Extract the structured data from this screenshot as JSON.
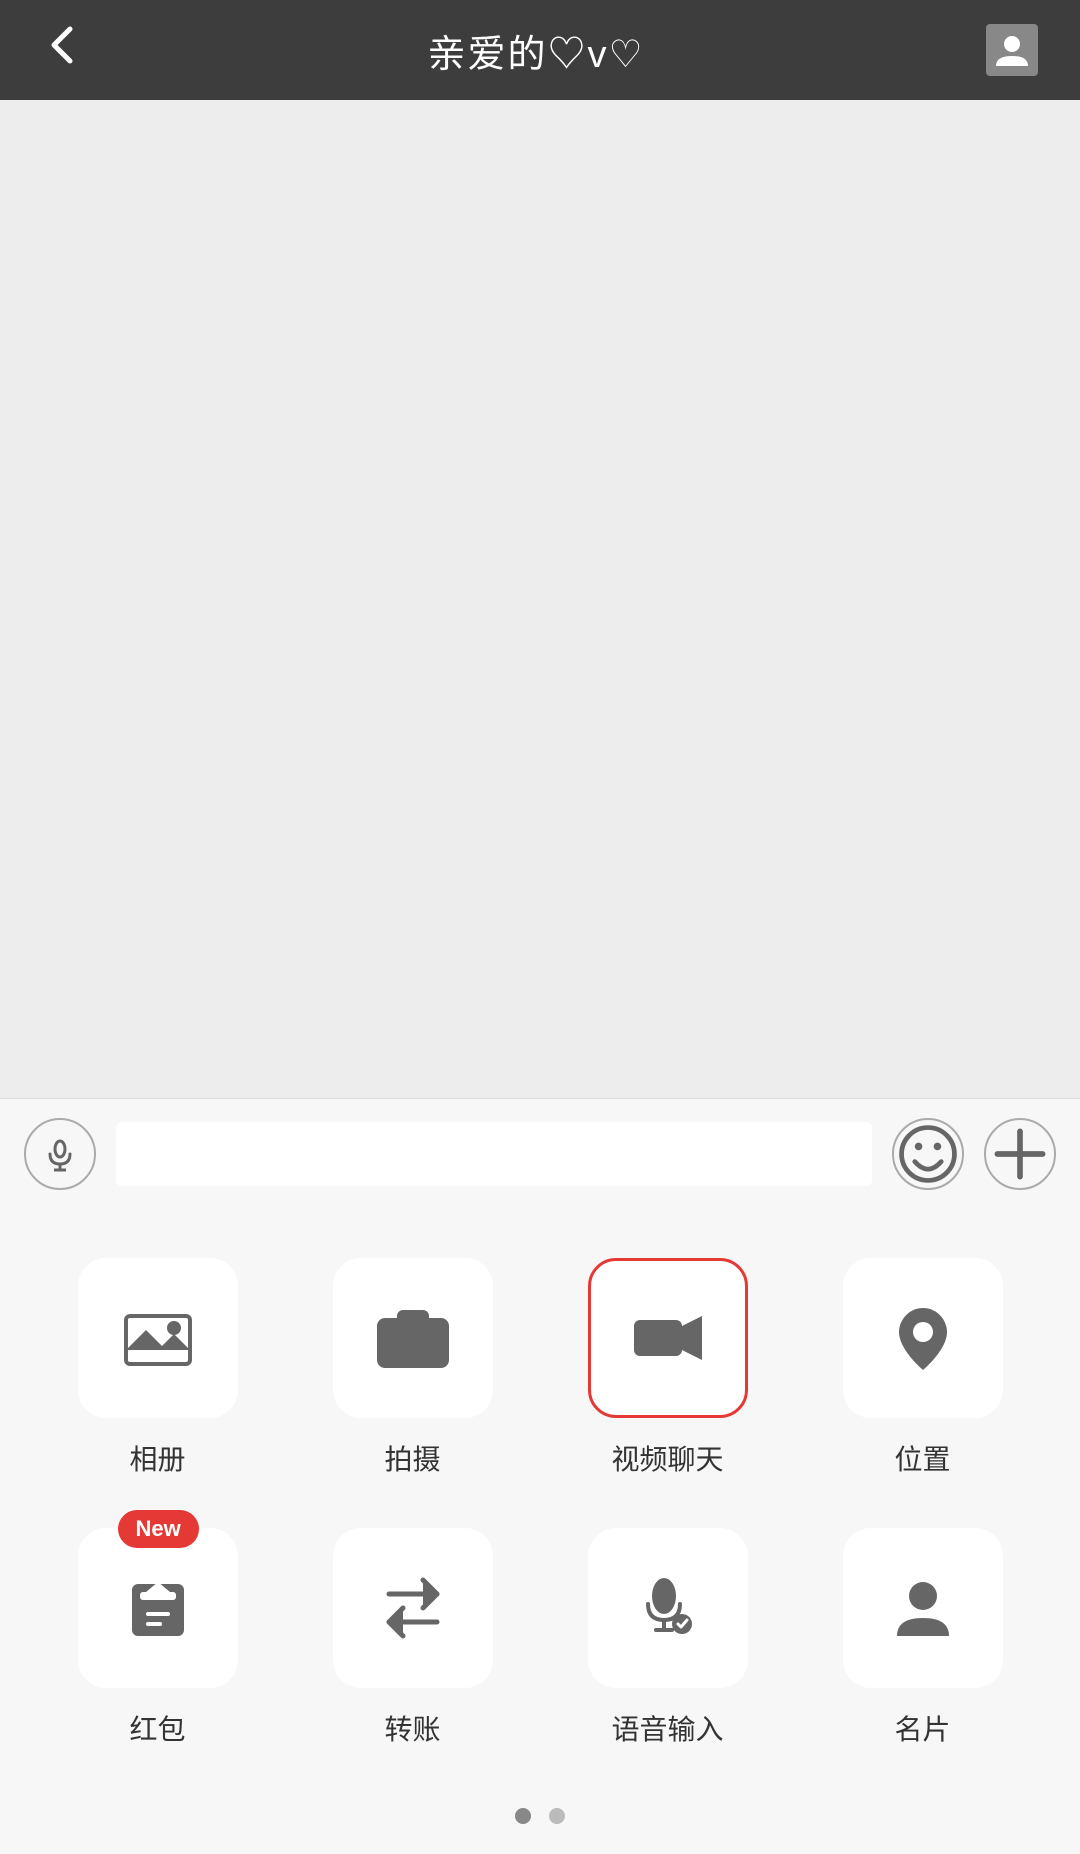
{
  "header": {
    "back_label": "←",
    "title": "亲爱的♡v♡",
    "avatar_label": "profile"
  },
  "input_bar": {
    "placeholder": "",
    "voice_label": "voice",
    "emoji_label": "emoji",
    "plus_label": "plus"
  },
  "action_panel": {
    "rows": [
      {
        "items": [
          {
            "id": "album",
            "label": "相册",
            "new_badge": false,
            "highlighted": false
          },
          {
            "id": "camera",
            "label": "拍摄",
            "new_badge": false,
            "highlighted": false
          },
          {
            "id": "video-chat",
            "label": "视频聊天",
            "new_badge": false,
            "highlighted": true
          },
          {
            "id": "location",
            "label": "位置",
            "new_badge": false,
            "highlighted": false
          }
        ]
      },
      {
        "items": [
          {
            "id": "red-packet",
            "label": "红包",
            "new_badge": true,
            "highlighted": false
          },
          {
            "id": "transfer",
            "label": "转账",
            "new_badge": false,
            "highlighted": false
          },
          {
            "id": "voice-input",
            "label": "语音输入",
            "new_badge": false,
            "highlighted": false
          },
          {
            "id": "business-card",
            "label": "名片",
            "new_badge": false,
            "highlighted": false
          }
        ]
      }
    ],
    "new_badge_text": "New"
  },
  "pagination": {
    "dots": [
      {
        "active": true
      },
      {
        "active": false
      }
    ]
  }
}
